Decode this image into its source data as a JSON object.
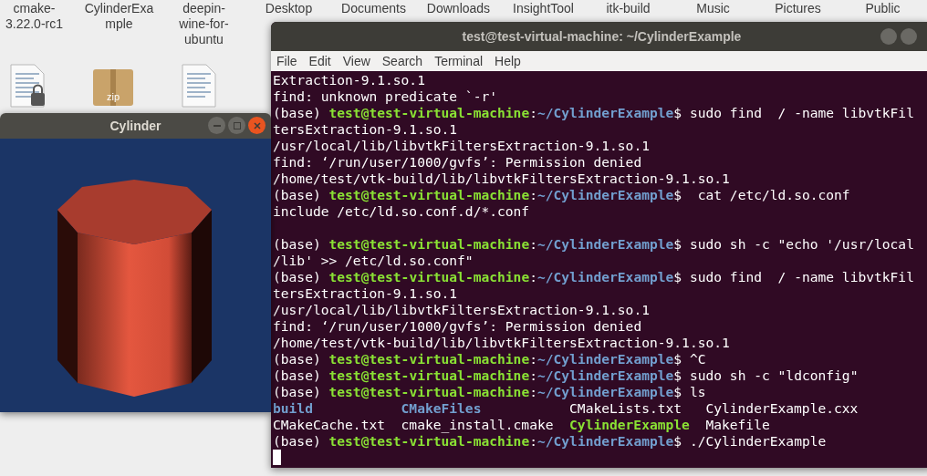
{
  "desktop": {
    "icons": [
      {
        "label": "cmake-3.22.0-rc1"
      },
      {
        "label": "CylinderExample"
      },
      {
        "label": "deepin-wine-for-ubuntu"
      },
      {
        "label": "Desktop"
      },
      {
        "label": "Documents"
      },
      {
        "label": "Downloads"
      },
      {
        "label": "InsightTool"
      },
      {
        "label": "itk-build"
      },
      {
        "label": "Music"
      },
      {
        "label": "Pictures"
      },
      {
        "label": "Public"
      }
    ],
    "files": [
      {
        "kind": "locked-text"
      },
      {
        "kind": "archive",
        "badge": "zip"
      },
      {
        "kind": "text"
      }
    ]
  },
  "terminal": {
    "title": "test@test-virtual-machine: ~/CylinderExample",
    "menu": [
      "File",
      "Edit",
      "View",
      "Search",
      "Terminal",
      "Help"
    ],
    "lines": [
      [
        {
          "kind": "plain",
          "text": "Extraction-9.1.so.1"
        }
      ],
      [
        {
          "kind": "plain",
          "text": "find: unknown predicate `-r'"
        }
      ],
      [
        {
          "kind": "plain",
          "text": "(base) "
        },
        {
          "kind": "user",
          "text": "test@test-virtual-machine"
        },
        {
          "kind": "plain",
          "text": ":"
        },
        {
          "kind": "path",
          "text": "~/CylinderExample"
        },
        {
          "kind": "plain",
          "text": "$ sudo find  / -name libvtkFil"
        }
      ],
      [
        {
          "kind": "plain",
          "text": "tersExtraction-9.1.so.1"
        }
      ],
      [
        {
          "kind": "plain",
          "text": "/usr/local/lib/libvtkFiltersExtraction-9.1.so.1"
        }
      ],
      [
        {
          "kind": "plain",
          "text": "find: ‘/run/user/1000/gvfs’: Permission denied"
        }
      ],
      [
        {
          "kind": "plain",
          "text": "/home/test/vtk-build/lib/libvtkFiltersExtraction-9.1.so.1"
        }
      ],
      [
        {
          "kind": "plain",
          "text": "(base) "
        },
        {
          "kind": "user",
          "text": "test@test-virtual-machine"
        },
        {
          "kind": "plain",
          "text": ":"
        },
        {
          "kind": "path",
          "text": "~/CylinderExample"
        },
        {
          "kind": "plain",
          "text": "$  cat /etc/ld.so.conf"
        }
      ],
      [
        {
          "kind": "plain",
          "text": "include /etc/ld.so.conf.d/*.conf"
        }
      ],
      [
        {
          "kind": "blank"
        }
      ],
      [
        {
          "kind": "plain",
          "text": "(base) "
        },
        {
          "kind": "user",
          "text": "test@test-virtual-machine"
        },
        {
          "kind": "plain",
          "text": ":"
        },
        {
          "kind": "path",
          "text": "~/CylinderExample"
        },
        {
          "kind": "plain",
          "text": "$ sudo sh -c \"echo '/usr/local"
        }
      ],
      [
        {
          "kind": "plain",
          "text": "/lib' >> /etc/ld.so.conf\""
        }
      ],
      [
        {
          "kind": "plain",
          "text": "(base) "
        },
        {
          "kind": "user",
          "text": "test@test-virtual-machine"
        },
        {
          "kind": "plain",
          "text": ":"
        },
        {
          "kind": "path",
          "text": "~/CylinderExample"
        },
        {
          "kind": "plain",
          "text": "$ sudo find  / -name libvtkFil"
        }
      ],
      [
        {
          "kind": "plain",
          "text": "tersExtraction-9.1.so.1"
        }
      ],
      [
        {
          "kind": "plain",
          "text": "/usr/local/lib/libvtkFiltersExtraction-9.1.so.1"
        }
      ],
      [
        {
          "kind": "plain",
          "text": "find: ‘/run/user/1000/gvfs’: Permission denied"
        }
      ],
      [
        {
          "kind": "plain",
          "text": "/home/test/vtk-build/lib/libvtkFiltersExtraction-9.1.so.1"
        }
      ],
      [
        {
          "kind": "plain",
          "text": "(base) "
        },
        {
          "kind": "user",
          "text": "test@test-virtual-machine"
        },
        {
          "kind": "plain",
          "text": ":"
        },
        {
          "kind": "path",
          "text": "~/CylinderExample"
        },
        {
          "kind": "plain",
          "text": "$ ^C"
        }
      ],
      [
        {
          "kind": "plain",
          "text": "(base) "
        },
        {
          "kind": "user",
          "text": "test@test-virtual-machine"
        },
        {
          "kind": "plain",
          "text": ":"
        },
        {
          "kind": "path",
          "text": "~/CylinderExample"
        },
        {
          "kind": "plain",
          "text": "$ sudo sh -c \"ldconfig\""
        }
      ],
      [
        {
          "kind": "plain",
          "text": "(base) "
        },
        {
          "kind": "user",
          "text": "test@test-virtual-machine"
        },
        {
          "kind": "plain",
          "text": ":"
        },
        {
          "kind": "path",
          "text": "~/CylinderExample"
        },
        {
          "kind": "plain",
          "text": "$ ls"
        }
      ],
      [
        {
          "kind": "dir",
          "text": "build"
        },
        {
          "kind": "dir",
          "text": "CMakeFiles"
        },
        {
          "kind": "plain",
          "text": "CMakeLists.txt"
        },
        {
          "kind": "plain",
          "text": "CylinderExample.cxx"
        }
      ],
      [
        {
          "kind": "plain",
          "text": "CMakeCache.txt"
        },
        {
          "kind": "plain",
          "text": "cmake_install.cmake"
        },
        {
          "kind": "exec",
          "text": "CylinderExample"
        },
        {
          "kind": "plain",
          "text": "Makefile"
        }
      ],
      [
        {
          "kind": "plain",
          "text": "(base) "
        },
        {
          "kind": "user",
          "text": "test@test-virtual-machine"
        },
        {
          "kind": "plain",
          "text": ":"
        },
        {
          "kind": "path",
          "text": "~/CylinderExample"
        },
        {
          "kind": "plain",
          "text": "$ ./CylinderExample"
        }
      ]
    ],
    "cursor": true
  },
  "viewer": {
    "title": "Cylinder"
  }
}
